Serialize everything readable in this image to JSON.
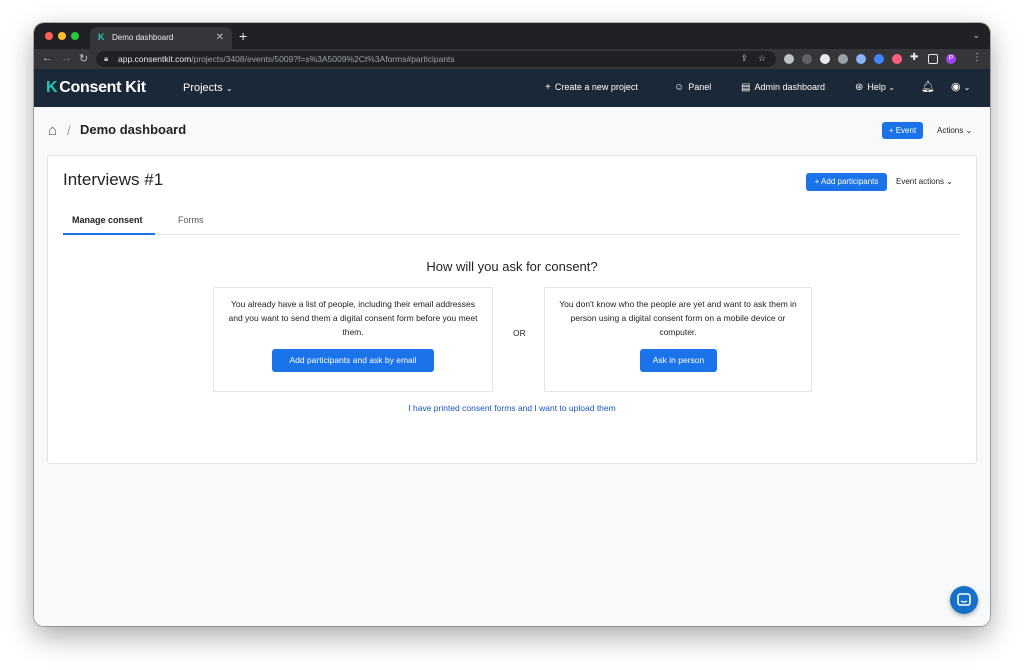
{
  "browser": {
    "tab_title": "Demo dashboard",
    "tab_favicon": "K",
    "new_tab": "+",
    "url_host": "app.consentkit.com",
    "url_path": "/projects/3408/events/5009?f=s%3A5009%2Ct%3Aforms#participants",
    "profile_initial": "P"
  },
  "appbar": {
    "logo_mark": "K",
    "logo_text": "Consent Kit",
    "projects_label": "Projects",
    "create_project": "Create a new project",
    "panel": "Panel",
    "admin_dashboard": "Admin dashboard",
    "help": "Help"
  },
  "page": {
    "breadcrumb_title": "Demo dashboard",
    "event_button": "+ Event",
    "actions_label": "Actions"
  },
  "card": {
    "title": "Interviews #1",
    "add_participants_button": "+ Add participants",
    "event_actions_label": "Event actions",
    "tabs": [
      "Manage consent",
      "Forms"
    ],
    "active_tab": "Manage consent",
    "question": "How will you ask for consent?",
    "option_email_text": "You already have a list of people, including their email addresses and you want to send them a digital consent form before you meet them.",
    "option_email_button": "Add participants and ask by email",
    "or_label": "OR",
    "option_person_text": "You don't know who the people are yet and want to ask them in person using a digital consent form on a mobile device or computer.",
    "option_person_button": "Ask in person",
    "upload_link": "I have printed consent forms and I want to upload them"
  },
  "colors": {
    "accent": "#1a73e8",
    "header_bg": "#1b2837",
    "logo_accent": "#26c6b7",
    "chat_bubble": "#1670c7"
  }
}
